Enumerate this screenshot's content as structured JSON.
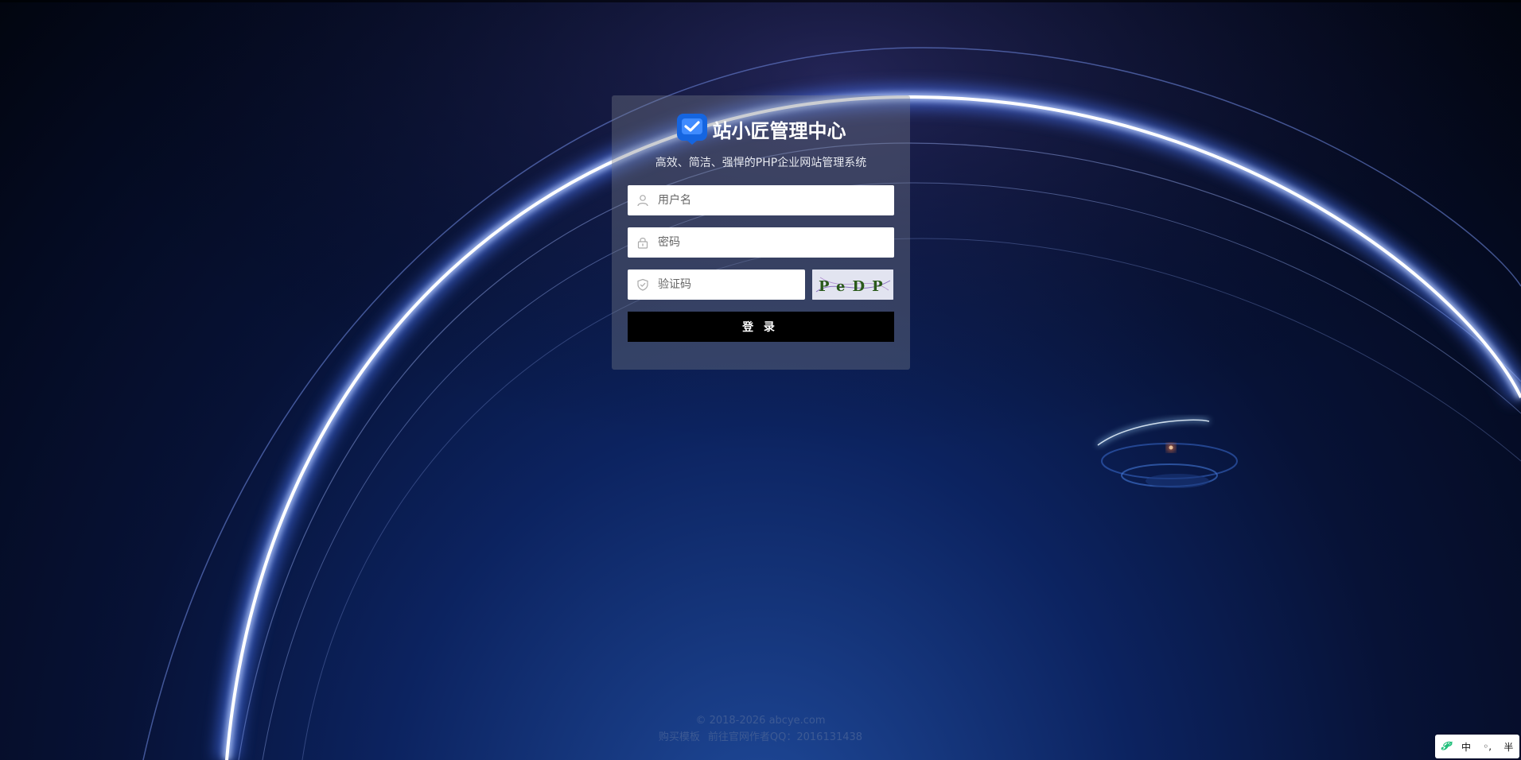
{
  "app": {
    "title": "站小匠管理中心",
    "subtitle": "高效、简洁、强悍的PHP企业网站管理系统"
  },
  "form": {
    "username_placeholder": "用户名",
    "password_placeholder": "密码",
    "captcha_placeholder": "验证码",
    "captcha_text": "PeDP",
    "submit_label": "登 录"
  },
  "footer": {
    "copyright": "© 2018-2026 abcye.com",
    "buy_link": "购买模板",
    "author_text": "前往官网作者QQ：2016131438"
  },
  "ime": {
    "logo": "𝓟",
    "mode": "中",
    "punct": "◦,",
    "width": "半"
  },
  "colors": {
    "accent": "#1565e0",
    "button": "#000000",
    "card": "rgba(120,125,140,0.38)",
    "glow": "#ffffff"
  },
  "icons": {
    "logo": "chat-check-icon",
    "username": "user-icon",
    "password": "lock-icon",
    "captcha": "shield-check-icon"
  }
}
